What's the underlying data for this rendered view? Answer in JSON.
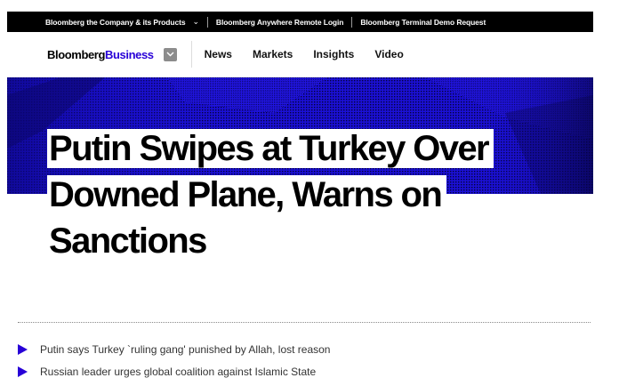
{
  "colors": {
    "accent": "#2800d7",
    "hero_blue": "#1a0fd2",
    "topbar_bg": "#000000"
  },
  "topbar": {
    "items": [
      {
        "label": "Bloomberg the Company & its Products",
        "icon": "chevron-down-icon"
      },
      {
        "label": "Bloomberg Anywhere Remote Login"
      },
      {
        "label": "Bloomberg Terminal Demo Request"
      }
    ]
  },
  "nav": {
    "logo_part1": "Bloomberg",
    "logo_part2": "Business",
    "menu_icon": "chevron-down-icon",
    "links": [
      "News",
      "Markets",
      "Insights",
      "Video"
    ]
  },
  "article": {
    "headline_lines": [
      "Putin Swipes at Turkey Over",
      "Downed Plane, Warns on",
      "Sanctions"
    ],
    "bullets": [
      "Putin says Turkey `ruling gang' punished by Allah, lost reason",
      "Russian leader urges global coalition against Islamic State"
    ],
    "bullet_icon": "triangle-right-icon"
  }
}
